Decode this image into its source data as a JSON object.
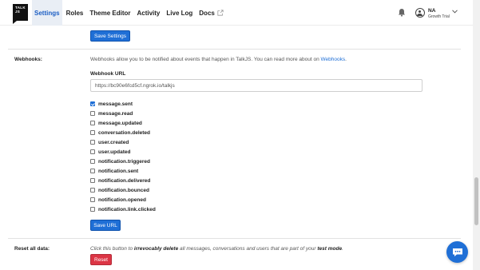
{
  "logo": {
    "text": "TALK JS"
  },
  "nav": {
    "items": [
      {
        "label": "Settings",
        "active": true
      },
      {
        "label": "Roles",
        "active": false
      },
      {
        "label": "Theme Editor",
        "active": false
      },
      {
        "label": "Activity",
        "active": false
      },
      {
        "label": "Live Log",
        "active": false
      },
      {
        "label": "Docs",
        "active": false,
        "icon": "external-link-icon"
      }
    ]
  },
  "account": {
    "name": "NA",
    "plan": "Growth Trial",
    "icons": [
      "bell-icon",
      "user-avatar-icon",
      "chevron-down-icon"
    ]
  },
  "settings": {
    "save_label": "Save Settings"
  },
  "webhooks": {
    "section_label": "Webhooks:",
    "description_prefix": "Webhooks allow you to be notified about events that happen in TalkJS. You can read more about on ",
    "description_link": "Webhooks",
    "description_suffix": ".",
    "url_label": "Webhook URL",
    "url_value": "https://bc90e6fcd5cf.ngrok.io/talkjs",
    "events": [
      {
        "label": "message.sent",
        "checked": true
      },
      {
        "label": "message.read",
        "checked": false
      },
      {
        "label": "message.updated",
        "checked": false
      },
      {
        "label": "conversation.deleted",
        "checked": false
      },
      {
        "label": "user.created",
        "checked": false
      },
      {
        "label": "user.updated",
        "checked": false
      },
      {
        "label": "notification.triggered",
        "checked": false
      },
      {
        "label": "notification.sent",
        "checked": false
      },
      {
        "label": "notification.delivered",
        "checked": false
      },
      {
        "label": "notification.bounced",
        "checked": false
      },
      {
        "label": "notification.opened",
        "checked": false
      },
      {
        "label": "notification.link.clicked",
        "checked": false
      }
    ],
    "save_url_label": "Save URL"
  },
  "reset": {
    "section_label": "Reset all data:",
    "desc_1": "Click this button to ",
    "desc_2": "irrevocably delete",
    "desc_3": " all messages, conversations and users that are part of your ",
    "desc_4": "test mode",
    "desc_5": ".",
    "button_label": "Reset"
  },
  "chat": {
    "icon": "chat-bubble-icon"
  },
  "colors": {
    "accent": "#1f6fd6",
    "danger": "#dc3545",
    "nav_active_bg": "#e9eef5"
  }
}
